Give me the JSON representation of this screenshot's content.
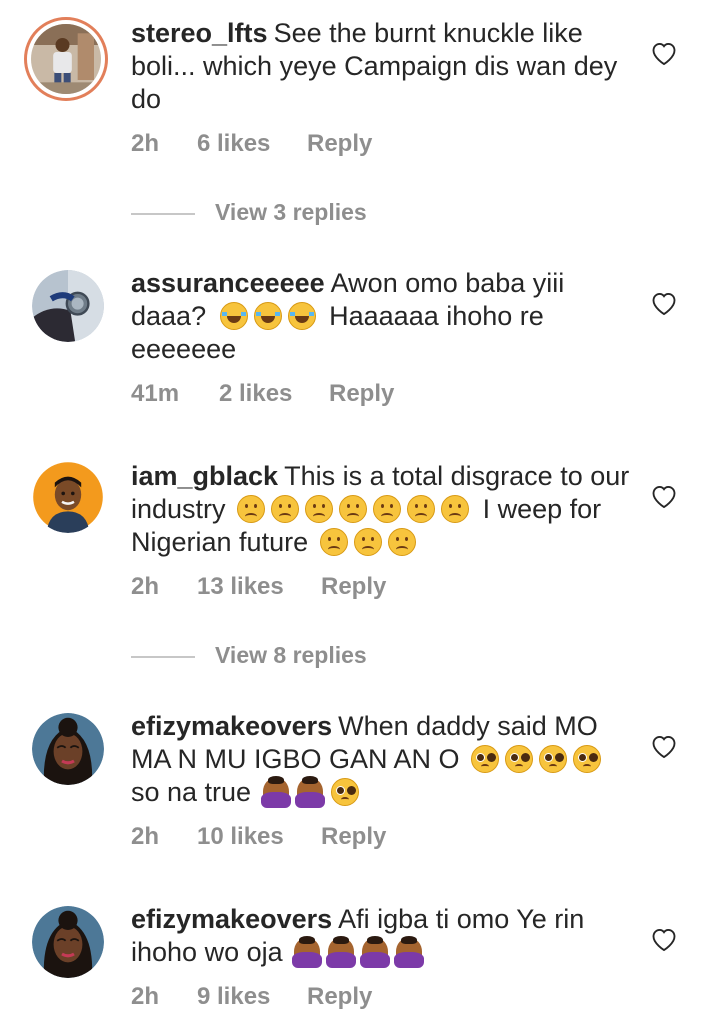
{
  "comments": [
    {
      "username": "stereo_lfts",
      "text": "See the burnt knuckle like boli... which yeye Campaign dis wan dey do",
      "emojis_after": [],
      "text_after": "",
      "emojis_tail": [],
      "time": "2h",
      "likes": "6 likes",
      "reply": "Reply",
      "view_replies": "View 3 replies",
      "avatar_icon": "avatar-photo-ring",
      "liked": false
    },
    {
      "username": "assuranceeeee",
      "text": "Awon omo baba yiii daaa?",
      "emojis_after": [
        "lol",
        "lol",
        "lol"
      ],
      "text_after": "Haaaaaa  ihoho re eeeeeee",
      "emojis_tail": [],
      "time": "41m",
      "likes": "2 likes",
      "reply": "Reply",
      "view_replies": "",
      "avatar_icon": "avatar-photo-watch",
      "liked": false
    },
    {
      "username": "iam_gblack",
      "text": "This is a total disgrace to our industry",
      "emojis_after": [
        "sad",
        "sad",
        "sad",
        "sad",
        "sad",
        "sad",
        "sad"
      ],
      "text_after": "I weep for Nigerian future",
      "emojis_tail": [
        "sad",
        "sad",
        "sad"
      ],
      "time": "2h",
      "likes": "13 likes",
      "reply": "Reply",
      "view_replies": "View 8 replies",
      "avatar_icon": "avatar-photo-orange",
      "liked": false
    },
    {
      "username": "efizymakeovers",
      "text": "When daddy said MO MA N MU IGBO GAN AN O",
      "emojis_after": [
        "plead",
        "plead",
        "plead",
        "plead"
      ],
      "text_after": "so na true",
      "emojis_tail": [
        "facepalm",
        "facepalm",
        "plead"
      ],
      "time": "2h",
      "likes": "10 likes",
      "reply": "Reply",
      "view_replies": "",
      "avatar_icon": "avatar-photo-woman",
      "liked": false
    },
    {
      "username": "efizymakeovers",
      "text": "Afi igba ti omo Ye rin ihoho wo oja",
      "emojis_after": [
        "facepalm",
        "facepalm",
        "facepalm",
        "facepalm"
      ],
      "text_after": "",
      "emojis_tail": [],
      "time": "2h",
      "likes": "9 likes",
      "reply": "Reply",
      "view_replies": "",
      "avatar_icon": "avatar-photo-woman",
      "liked": false
    }
  ],
  "colors": {
    "text": "#262626",
    "secondary": "#8e8e8e",
    "divider": "#c7c7c7",
    "story_ring": "#e27f5a"
  }
}
